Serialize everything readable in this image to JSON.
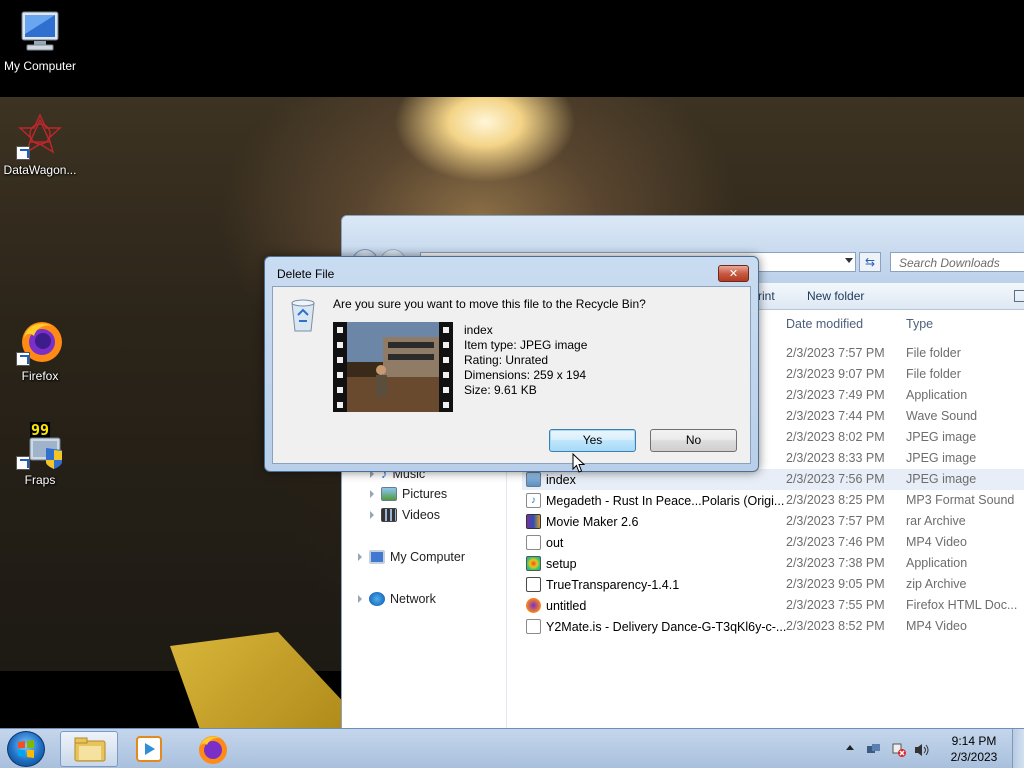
{
  "desktop": {
    "icons": [
      {
        "label": "My Computer"
      },
      {
        "label": "DataWagon..."
      },
      {
        "label": "Firefox"
      },
      {
        "label": "Fraps",
        "badge": "99"
      }
    ]
  },
  "explorer": {
    "search_placeholder": "Search Downloads",
    "toolbar": {
      "print": "rint",
      "new_folder": "New folder"
    },
    "columns": {
      "date": "Date modified",
      "type": "Type"
    },
    "nav": [
      {
        "label": "Music"
      },
      {
        "label": "Pictures"
      },
      {
        "label": "Videos"
      },
      {
        "label": "My Computer"
      },
      {
        "label": "Network"
      }
    ],
    "files": [
      {
        "name": "",
        "date": "2/3/2023 7:57 PM",
        "type": "File folder"
      },
      {
        "name": "",
        "date": "2/3/2023 9:07 PM",
        "type": "File folder"
      },
      {
        "name": "",
        "date": "2/3/2023 7:49 PM",
        "type": "Application"
      },
      {
        "name": "",
        "date": "2/3/2023 7:44 PM",
        "type": "Wave Sound"
      },
      {
        "name": "",
        "date": "2/3/2023 8:02 PM",
        "type": "JPEG image"
      },
      {
        "name": "",
        "date": "2/3/2023 8:33 PM",
        "type": "JPEG image"
      },
      {
        "name": "index",
        "date": "2/3/2023 7:56 PM",
        "type": "JPEG image"
      },
      {
        "name": "Megadeth - Rust In Peace...Polaris (Origi...",
        "date": "2/3/2023 8:25 PM",
        "type": "MP3 Format Sound"
      },
      {
        "name": "Movie Maker 2.6",
        "date": "2/3/2023 7:57 PM",
        "type": "rar Archive"
      },
      {
        "name": "out",
        "date": "2/3/2023 7:46 PM",
        "type": "MP4 Video"
      },
      {
        "name": "setup",
        "date": "2/3/2023 7:38 PM",
        "type": "Application"
      },
      {
        "name": "TrueTransparency-1.4.1",
        "date": "2/3/2023 9:05 PM",
        "type": "zip Archive"
      },
      {
        "name": "untitled",
        "date": "2/3/2023 7:55 PM",
        "type": "Firefox HTML Doc..."
      },
      {
        "name": "Y2Mate.is - Delivery Dance-G-T3qKl6y-c-...",
        "date": "2/3/2023 8:52 PM",
        "type": "MP4 Video"
      }
    ]
  },
  "dialog": {
    "title": "Delete File",
    "close": "✕",
    "question": "Are you sure you want to move this file to the Recycle Bin?",
    "details": {
      "name": "index",
      "item_type": "Item type: JPEG image",
      "rating": "Rating: Unrated",
      "dimensions": "Dimensions: 259 x 194",
      "size": "Size: 9.61 KB"
    },
    "yes": "Yes",
    "no": "No"
  },
  "taskbar": {
    "time": "9:14 PM",
    "date": "2/3/2023"
  }
}
